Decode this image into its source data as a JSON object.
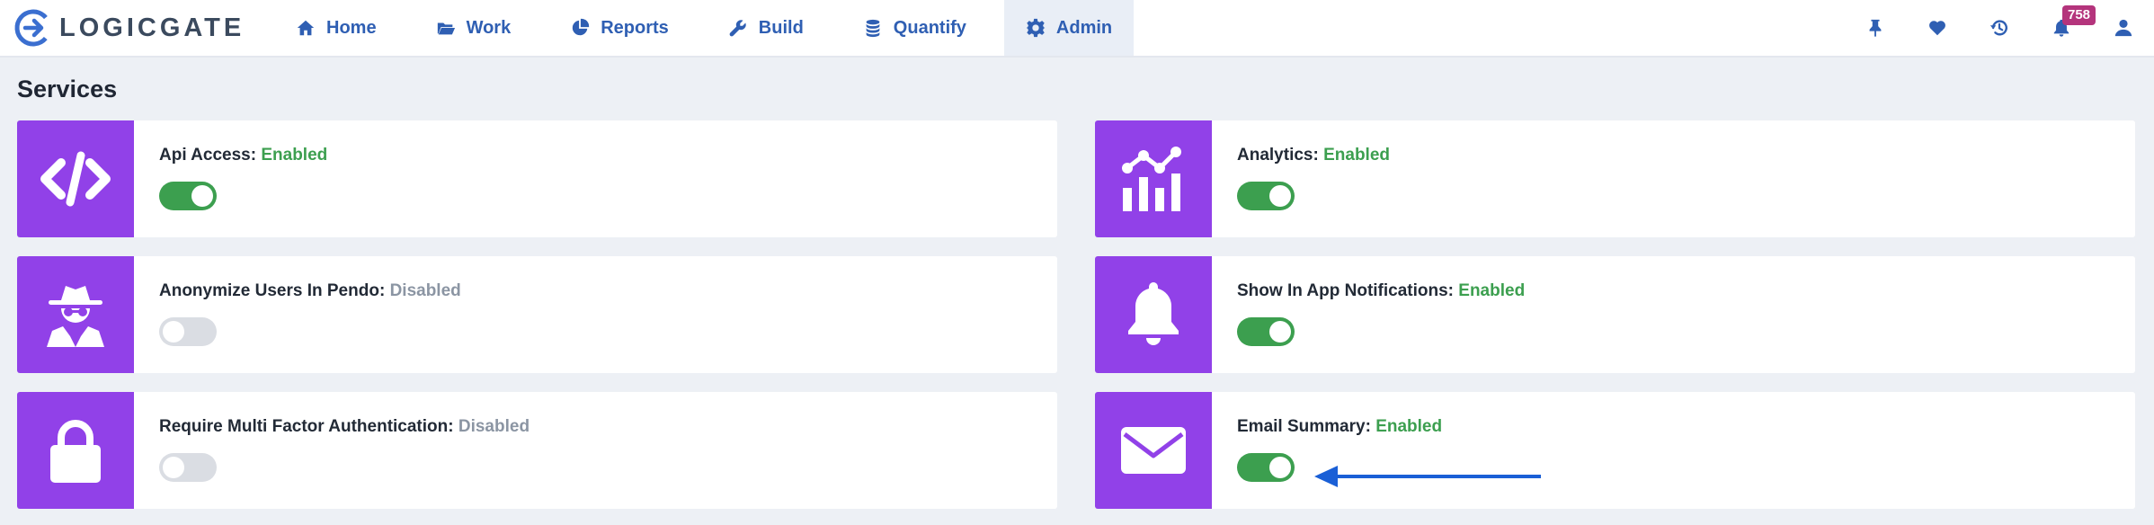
{
  "brand": {
    "name": "LOGICGATE"
  },
  "nav": {
    "items": [
      {
        "label": "Home",
        "icon": "home-icon"
      },
      {
        "label": "Work",
        "icon": "folder-open-icon"
      },
      {
        "label": "Reports",
        "icon": "pie-chart-icon"
      },
      {
        "label": "Build",
        "icon": "wrench-icon"
      },
      {
        "label": "Quantify",
        "icon": "coins-icon"
      },
      {
        "label": "Admin",
        "icon": "gear-icon",
        "active": true
      }
    ]
  },
  "header_icons": {
    "pin": "pin-icon",
    "favorites": "heart-icon",
    "history": "history-icon",
    "notifications": {
      "icon": "bell-icon",
      "count": "758"
    },
    "user": "user-icon"
  },
  "page": {
    "title": "Services"
  },
  "services": [
    {
      "name": "Api Access:",
      "status": "Enabled",
      "enabled": true,
      "icon": "code-icon"
    },
    {
      "name": "Analytics:",
      "status": "Enabled",
      "enabled": true,
      "icon": "analytics-icon"
    },
    {
      "name": "Anonymize Users In Pendo:",
      "status": "Disabled",
      "enabled": false,
      "icon": "user-secret-icon"
    },
    {
      "name": "Show In App Notifications:",
      "status": "Enabled",
      "enabled": true,
      "icon": "bell-icon"
    },
    {
      "name": "Require Multi Factor Authentication:",
      "status": "Disabled",
      "enabled": false,
      "icon": "lock-icon"
    },
    {
      "name": "Email Summary:",
      "status": "Enabled",
      "enabled": true,
      "icon": "envelope-icon"
    }
  ],
  "colors": {
    "accent": "#9141e8",
    "nav_text": "#2f5fb3",
    "enabled": "#3c9f4f",
    "disabled": "#8b95a3",
    "badge": "#b4347c",
    "annotation_arrow": "#1a5fd6"
  }
}
